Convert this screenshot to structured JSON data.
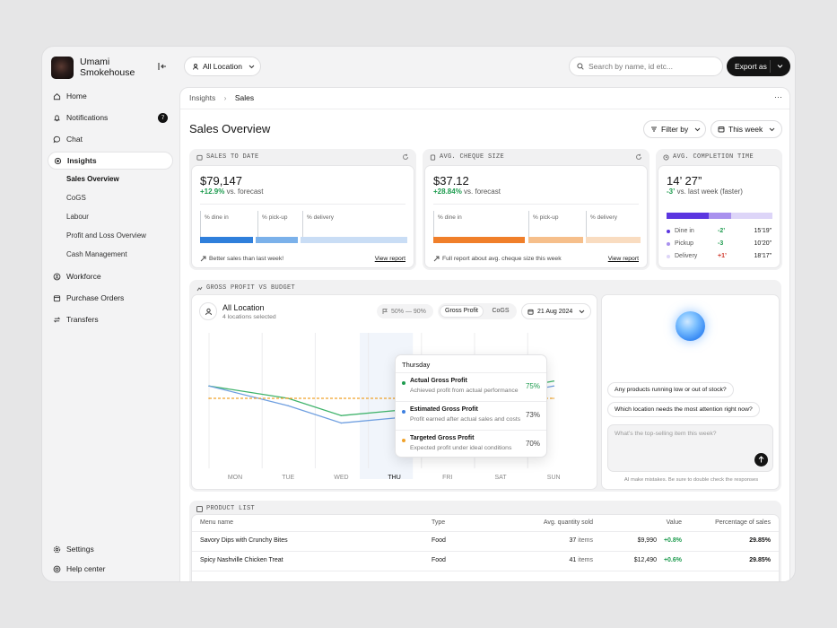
{
  "brand": {
    "name": "Umami Smokehouse"
  },
  "sidebar": {
    "items": [
      {
        "label": "Home"
      },
      {
        "label": "Notifications",
        "badge": "7"
      },
      {
        "label": "Chat"
      },
      {
        "label": "Insights"
      },
      {
        "label": "Workforce"
      },
      {
        "label": "Purchase Orders"
      },
      {
        "label": "Transfers"
      }
    ],
    "insights_sub": [
      "Sales Overview",
      "CoGS",
      "Labour",
      "Profit and Loss Overview",
      "Cash Management"
    ],
    "bottom": [
      {
        "label": "Settings"
      },
      {
        "label": "Help center"
      }
    ]
  },
  "topbar": {
    "location": "All Location",
    "search_placeholder": "Search by name, id etc...",
    "export_label": "Export as"
  },
  "breadcrumb": {
    "parent": "Insights",
    "current": "Sales",
    "more": "···"
  },
  "page": {
    "title": "Sales Overview",
    "filter_label": "Filter by",
    "period_label": "This week"
  },
  "cards": {
    "sales": {
      "head": "SALES TO DATE",
      "value": "$79,147",
      "delta": "+12.9%",
      "delta_text": "vs. forecast",
      "segments": [
        "% dine in",
        "% pick-up",
        "% delivery"
      ],
      "footer": "Better sales than last week!",
      "link": "View report",
      "colors": [
        "#2f7fdb",
        "#7bb1ea",
        "#c9ddf5"
      ]
    },
    "cheque": {
      "head": "AVG. CHEQUE SIZE",
      "value": "$37.12",
      "delta": "+28.84%",
      "delta_text": "vs. forecast",
      "segments": [
        "% dine in",
        "% pick-up",
        "% delivery"
      ],
      "footer": "Full report about avg. cheque size this week",
      "link": "View report",
      "colors": [
        "#f07f2a",
        "#f6bf8b",
        "#f9dcc0"
      ]
    },
    "completion": {
      "head": "AVG. COMPLETION TIME",
      "value": "14’ 27”",
      "delta": "-3’",
      "delta_text": "vs. last week (faster)",
      "rows": [
        {
          "label": "Dine in",
          "delta": "-2’",
          "time": "15’19”"
        },
        {
          "label": "Pickup",
          "delta": "-3",
          "time": "10’20”"
        },
        {
          "label": "Delivery",
          "delta": "+1’",
          "time": "18’17”"
        }
      ],
      "colors": [
        "#5b36e0",
        "#a991ee",
        "#ddd5f8"
      ]
    }
  },
  "gross": {
    "head": "GROSS PROFIT VS BUDGET",
    "location": "All Location",
    "location_sub": "4 locations selected",
    "range": "50% — 90%",
    "tab_on": "Gross Profit",
    "tab_off": "CoGS",
    "date": "21 Aug 2024",
    "tooltip": {
      "day": "Thursday",
      "rows": [
        {
          "name": "Actual Gross Profit",
          "desc": "Achieved profit from actual performance",
          "pct": "75%",
          "color": "#1d9b4e"
        },
        {
          "name": "Estimated Gross Profit",
          "desc": "Profit earned after actual sales and costs",
          "pct": "73%",
          "color": "#3d7fe0"
        },
        {
          "name": "Targeted Gross Profit",
          "desc": "Expected profit under ideal conditions",
          "pct": "70%",
          "color": "#f0a22a"
        }
      ]
    }
  },
  "chart_data": {
    "type": "line",
    "categories": [
      "MON",
      "TUE",
      "WED",
      "THU",
      "FRI",
      "SAT",
      "SUN"
    ],
    "series": [
      {
        "name": "Actual Gross Profit",
        "values": [
          75,
          70,
          63,
          65,
          75,
          73,
          77
        ],
        "color": "#3fb36b"
      },
      {
        "name": "Estimated Gross Profit",
        "values": [
          75,
          67,
          60,
          62,
          73,
          71,
          75
        ],
        "color": "#6f9fe0"
      },
      {
        "name": "Targeted Gross Profit",
        "values": [
          70,
          70,
          70,
          70,
          70,
          70,
          70
        ],
        "color": "#f0a22a"
      }
    ],
    "ylim": [
      50,
      90
    ],
    "highlight": "THU"
  },
  "ai": {
    "suggestions": [
      "Any products running low or out of stock?",
      "Which location needs the most attention right now?"
    ],
    "placeholder": "What’s the top-selling item this week?",
    "disclaimer": "AI make mistakes. Be sure to double check the responses"
  },
  "products": {
    "head": "PRODUCT LIST",
    "columns": [
      "Menu name",
      "Type",
      "Avg. quantity sold",
      "Value",
      "Percentage of sales"
    ],
    "rows": [
      {
        "name": "Savory Dips with Crunchy Bites",
        "type": "Food",
        "qty": "37",
        "unit": "items",
        "value": "$9,990",
        "change": "+0.8%",
        "pct": "29.85%"
      },
      {
        "name": "Spicy Nashville Chicken Treat",
        "type": "Food",
        "qty": "41",
        "unit": "items",
        "value": "$12,490",
        "change": "+0.6%",
        "pct": "29.85%"
      }
    ]
  }
}
